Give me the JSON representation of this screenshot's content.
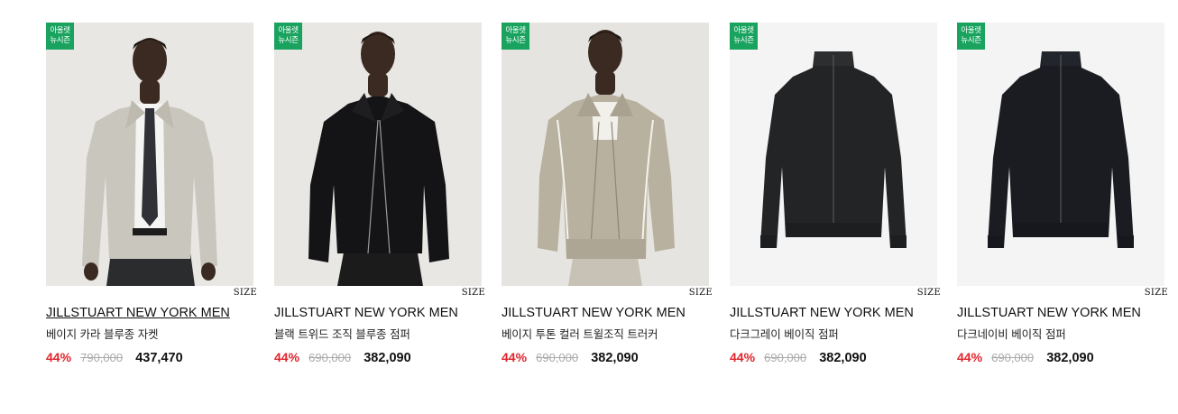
{
  "products": [
    {
      "badge_line1": "아울렛",
      "badge_line2": "뉴시즌",
      "size_label": "SIZE",
      "brand": "JILLSTUART NEW YORK MEN",
      "name": "베이지 카라 블루종 자켓",
      "discount": "44%",
      "original_price": "790,000",
      "sale_price": "437,470"
    },
    {
      "badge_line1": "아울렛",
      "badge_line2": "뉴시즌",
      "size_label": "SIZE",
      "brand": "JILLSTUART NEW YORK MEN",
      "name": "블랙 트위드 조직 블루종 점퍼",
      "discount": "44%",
      "original_price": "690,000",
      "sale_price": "382,090"
    },
    {
      "badge_line1": "아울렛",
      "badge_line2": "뉴시즌",
      "size_label": "SIZE",
      "brand": "JILLSTUART NEW YORK MEN",
      "name": "베이지 투톤 컬러 트윌조직 트러커",
      "discount": "44%",
      "original_price": "690,000",
      "sale_price": "382,090"
    },
    {
      "badge_line1": "아울렛",
      "badge_line2": "뉴시즌",
      "size_label": "SIZE",
      "brand": "JILLSTUART NEW YORK MEN",
      "name": "다크그레이 베이직 점퍼",
      "discount": "44%",
      "original_price": "690,000",
      "sale_price": "382,090"
    },
    {
      "badge_line1": "아울렛",
      "badge_line2": "뉴시즌",
      "size_label": "SIZE",
      "brand": "JILLSTUART NEW YORK MEN",
      "name": "다크네이비 베이직 점퍼",
      "discount": "44%",
      "original_price": "690,000",
      "sale_price": "382,090"
    }
  ],
  "colors": {
    "badge_green": "#1aa35f",
    "discount_red": "#e0242b",
    "strike_gray": "#aaaaaa"
  }
}
